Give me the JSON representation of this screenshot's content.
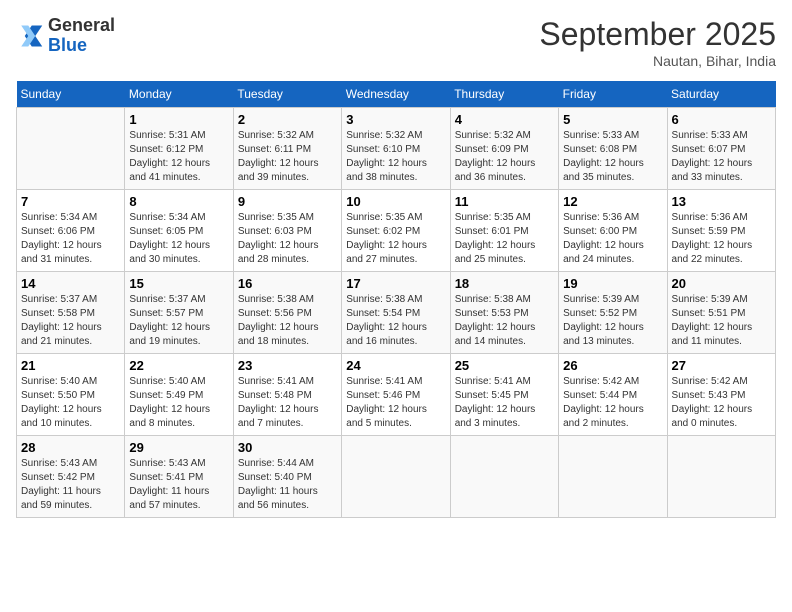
{
  "header": {
    "logo": {
      "general": "General",
      "blue": "Blue"
    },
    "title": "September 2025",
    "location": "Nautan, Bihar, India"
  },
  "weekdays": [
    "Sunday",
    "Monday",
    "Tuesday",
    "Wednesday",
    "Thursday",
    "Friday",
    "Saturday"
  ],
  "weeks": [
    [
      {
        "date": "",
        "text": ""
      },
      {
        "date": "1",
        "text": "Sunrise: 5:31 AM\nSunset: 6:12 PM\nDaylight: 12 hours\nand 41 minutes."
      },
      {
        "date": "2",
        "text": "Sunrise: 5:32 AM\nSunset: 6:11 PM\nDaylight: 12 hours\nand 39 minutes."
      },
      {
        "date": "3",
        "text": "Sunrise: 5:32 AM\nSunset: 6:10 PM\nDaylight: 12 hours\nand 38 minutes."
      },
      {
        "date": "4",
        "text": "Sunrise: 5:32 AM\nSunset: 6:09 PM\nDaylight: 12 hours\nand 36 minutes."
      },
      {
        "date": "5",
        "text": "Sunrise: 5:33 AM\nSunset: 6:08 PM\nDaylight: 12 hours\nand 35 minutes."
      },
      {
        "date": "6",
        "text": "Sunrise: 5:33 AM\nSunset: 6:07 PM\nDaylight: 12 hours\nand 33 minutes."
      }
    ],
    [
      {
        "date": "7",
        "text": "Sunrise: 5:34 AM\nSunset: 6:06 PM\nDaylight: 12 hours\nand 31 minutes."
      },
      {
        "date": "8",
        "text": "Sunrise: 5:34 AM\nSunset: 6:05 PM\nDaylight: 12 hours\nand 30 minutes."
      },
      {
        "date": "9",
        "text": "Sunrise: 5:35 AM\nSunset: 6:03 PM\nDaylight: 12 hours\nand 28 minutes."
      },
      {
        "date": "10",
        "text": "Sunrise: 5:35 AM\nSunset: 6:02 PM\nDaylight: 12 hours\nand 27 minutes."
      },
      {
        "date": "11",
        "text": "Sunrise: 5:35 AM\nSunset: 6:01 PM\nDaylight: 12 hours\nand 25 minutes."
      },
      {
        "date": "12",
        "text": "Sunrise: 5:36 AM\nSunset: 6:00 PM\nDaylight: 12 hours\nand 24 minutes."
      },
      {
        "date": "13",
        "text": "Sunrise: 5:36 AM\nSunset: 5:59 PM\nDaylight: 12 hours\nand 22 minutes."
      }
    ],
    [
      {
        "date": "14",
        "text": "Sunrise: 5:37 AM\nSunset: 5:58 PM\nDaylight: 12 hours\nand 21 minutes."
      },
      {
        "date": "15",
        "text": "Sunrise: 5:37 AM\nSunset: 5:57 PM\nDaylight: 12 hours\nand 19 minutes."
      },
      {
        "date": "16",
        "text": "Sunrise: 5:38 AM\nSunset: 5:56 PM\nDaylight: 12 hours\nand 18 minutes."
      },
      {
        "date": "17",
        "text": "Sunrise: 5:38 AM\nSunset: 5:54 PM\nDaylight: 12 hours\nand 16 minutes."
      },
      {
        "date": "18",
        "text": "Sunrise: 5:38 AM\nSunset: 5:53 PM\nDaylight: 12 hours\nand 14 minutes."
      },
      {
        "date": "19",
        "text": "Sunrise: 5:39 AM\nSunset: 5:52 PM\nDaylight: 12 hours\nand 13 minutes."
      },
      {
        "date": "20",
        "text": "Sunrise: 5:39 AM\nSunset: 5:51 PM\nDaylight: 12 hours\nand 11 minutes."
      }
    ],
    [
      {
        "date": "21",
        "text": "Sunrise: 5:40 AM\nSunset: 5:50 PM\nDaylight: 12 hours\nand 10 minutes."
      },
      {
        "date": "22",
        "text": "Sunrise: 5:40 AM\nSunset: 5:49 PM\nDaylight: 12 hours\nand 8 minutes."
      },
      {
        "date": "23",
        "text": "Sunrise: 5:41 AM\nSunset: 5:48 PM\nDaylight: 12 hours\nand 7 minutes."
      },
      {
        "date": "24",
        "text": "Sunrise: 5:41 AM\nSunset: 5:46 PM\nDaylight: 12 hours\nand 5 minutes."
      },
      {
        "date": "25",
        "text": "Sunrise: 5:41 AM\nSunset: 5:45 PM\nDaylight: 12 hours\nand 3 minutes."
      },
      {
        "date": "26",
        "text": "Sunrise: 5:42 AM\nSunset: 5:44 PM\nDaylight: 12 hours\nand 2 minutes."
      },
      {
        "date": "27",
        "text": "Sunrise: 5:42 AM\nSunset: 5:43 PM\nDaylight: 12 hours\nand 0 minutes."
      }
    ],
    [
      {
        "date": "28",
        "text": "Sunrise: 5:43 AM\nSunset: 5:42 PM\nDaylight: 11 hours\nand 59 minutes."
      },
      {
        "date": "29",
        "text": "Sunrise: 5:43 AM\nSunset: 5:41 PM\nDaylight: 11 hours\nand 57 minutes."
      },
      {
        "date": "30",
        "text": "Sunrise: 5:44 AM\nSunset: 5:40 PM\nDaylight: 11 hours\nand 56 minutes."
      },
      {
        "date": "",
        "text": ""
      },
      {
        "date": "",
        "text": ""
      },
      {
        "date": "",
        "text": ""
      },
      {
        "date": "",
        "text": ""
      }
    ]
  ]
}
